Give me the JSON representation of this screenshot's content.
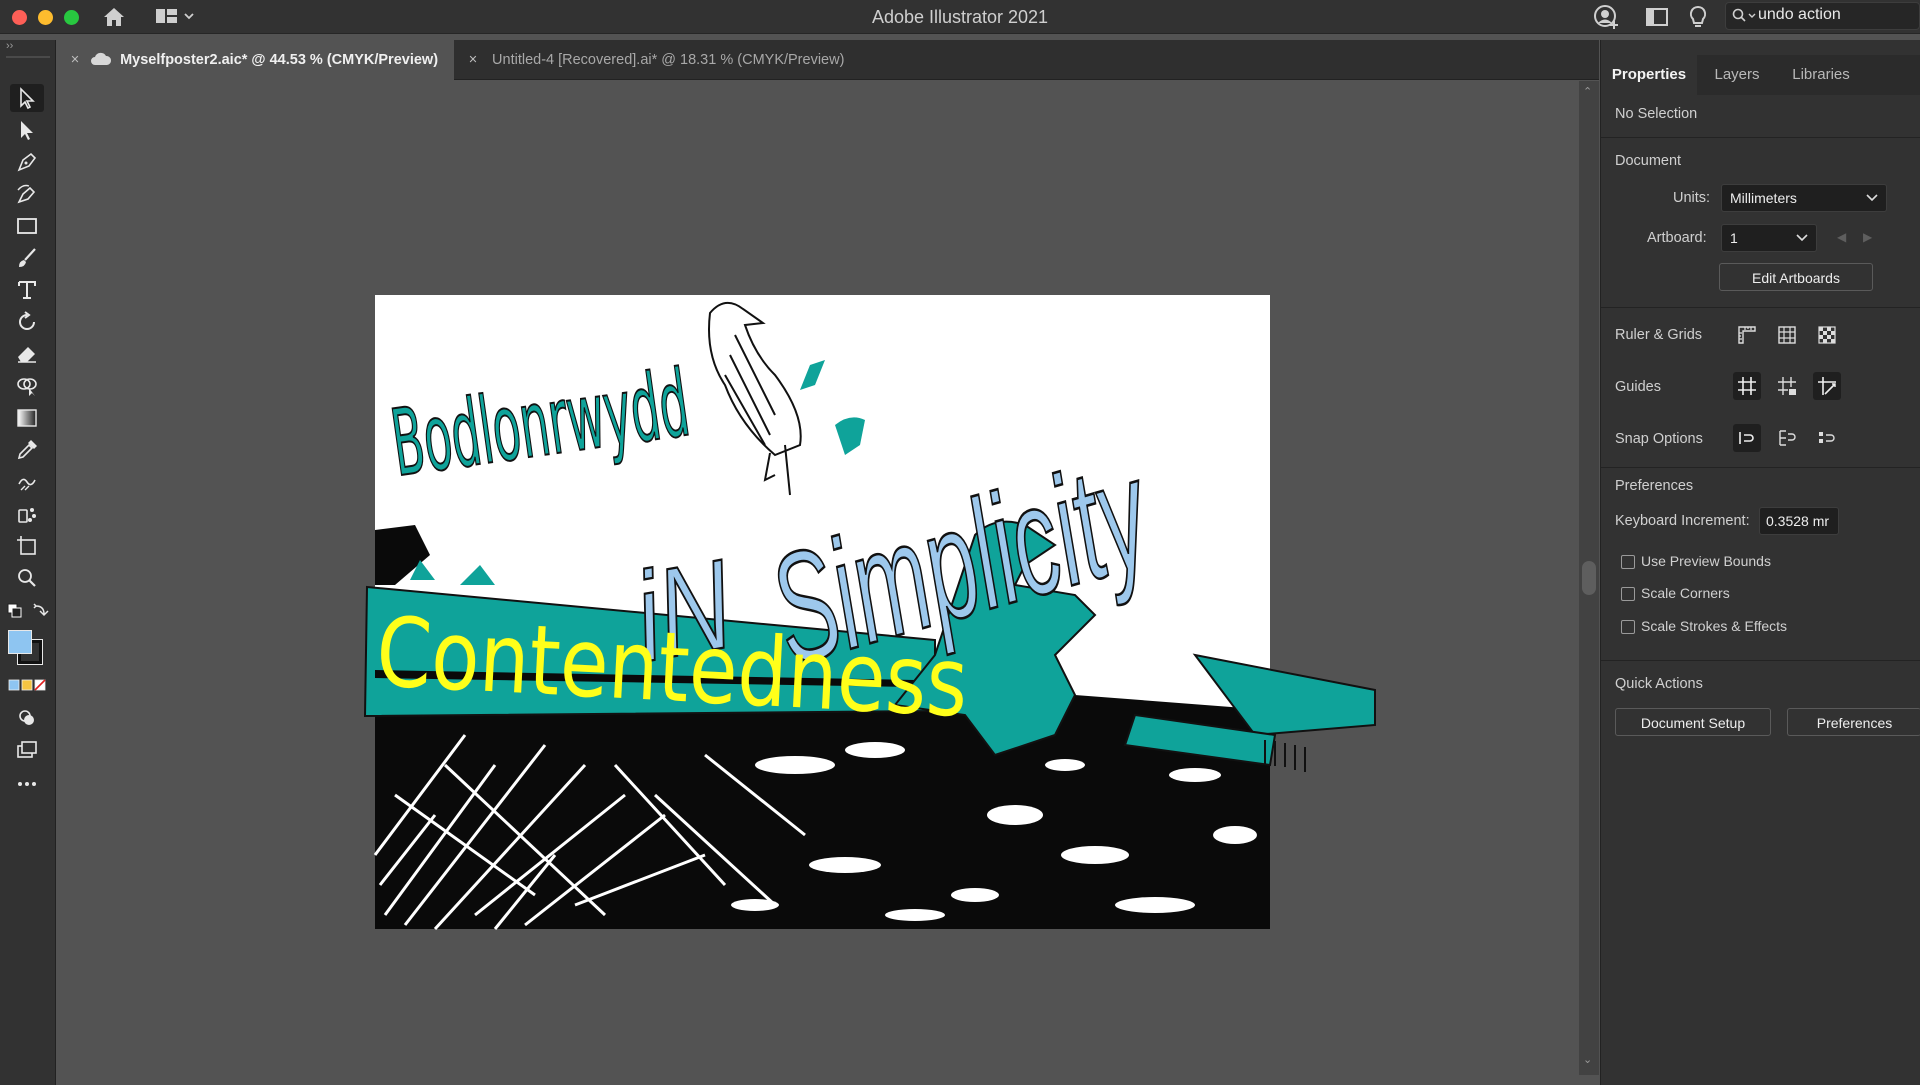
{
  "app": {
    "title": "Adobe Illustrator 2021",
    "search_value": "undo action"
  },
  "tabs": [
    {
      "label": "Myselfposter2.aic* @ 44.53 % (CMYK/Preview)",
      "active": true
    },
    {
      "label": "Untitled-4 [Recovered].ai* @ 18.31 % (CMYK/Preview)",
      "active": false
    }
  ],
  "artwork": {
    "text_bodlonrwydd": "Bodlonrwydd",
    "text_in": "iN",
    "text_simplicity": "Simplicity",
    "text_contentedness": "Contentedness"
  },
  "panel": {
    "tabs": [
      "Properties",
      "Layers",
      "Libraries"
    ],
    "selection": "No Selection",
    "document_heading": "Document",
    "units_label": "Units:",
    "units_value": "Millimeters",
    "artboard_label": "Artboard:",
    "artboard_value": "1",
    "edit_artboards": "Edit Artboards",
    "ruler_grids": "Ruler & Grids",
    "guides": "Guides",
    "snap_options": "Snap Options",
    "preferences_heading": "Preferences",
    "keyboard_increment_label": "Keyboard Increment:",
    "keyboard_increment_value": "0.3528 mr",
    "checkboxes": [
      "Use Preview Bounds",
      "Scale Corners",
      "Scale Strokes & Effects"
    ],
    "quick_actions": "Quick Actions",
    "document_setup": "Document Setup",
    "preferences_button": "Preferences"
  },
  "colors": {
    "teal": "#0fa39a",
    "yellow": "#ffff1a",
    "light_blue": "#9dc8ec",
    "fill_swatch": "#8ec5f1"
  }
}
